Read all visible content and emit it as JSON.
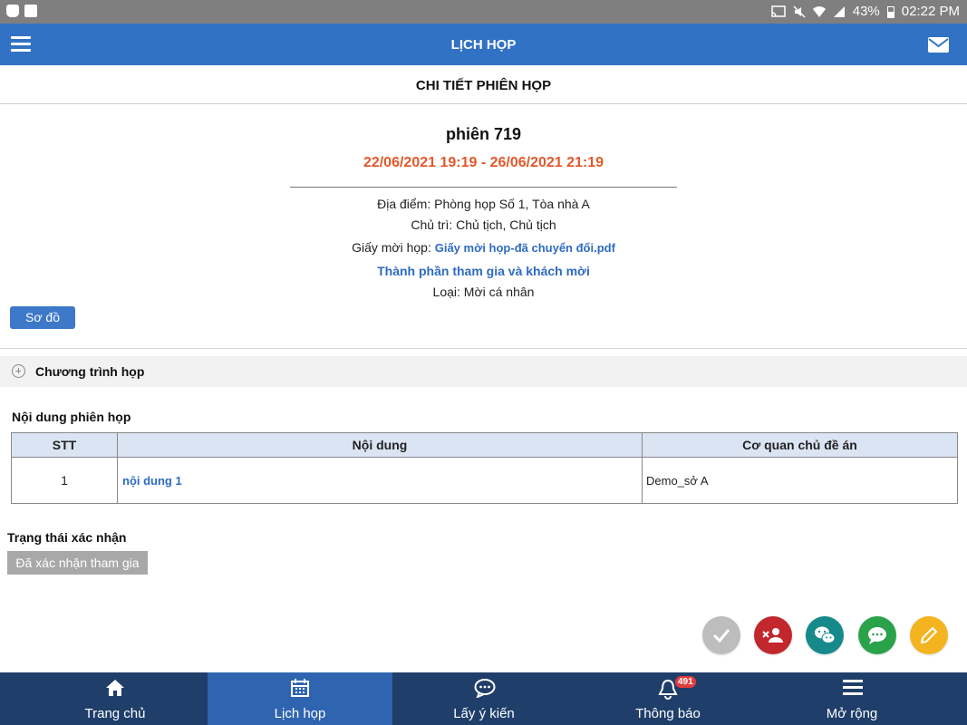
{
  "status_bar": {
    "battery": "43%",
    "time": "02:22 PM"
  },
  "app_bar": {
    "title": "LỊCH HỌP"
  },
  "sub_header": {
    "title": "CHI TIẾT PHIÊN HỌP"
  },
  "session": {
    "title": "phiên 719",
    "time_range": "22/06/2021 19:19 - 26/06/2021 21:19",
    "location_label": "Địa điểm: ",
    "location_value": "Phòng họp Số 1, Tòa nhà A",
    "chair_label": "Chủ trì: ",
    "chair_value": "Chủ tịch, Chủ tịch",
    "invitation_label": "Giấy mời họp: ",
    "invitation_file": "Giấy mời họp-đã chuyển đổi.pdf",
    "participants_link": "Thành phần tham gia và khách mời",
    "type_label": "Loại: ",
    "type_value": "Mời cá nhân"
  },
  "buttons": {
    "diagram": "Sơ đồ"
  },
  "program": {
    "label": "Chương trình họp"
  },
  "content_section": {
    "title": "Nội dung phiên họp",
    "columns": [
      "STT",
      "Nội dung",
      "Cơ quan chủ đề án"
    ],
    "rows": [
      {
        "stt": "1",
        "content": "nội dung 1",
        "agency": "Demo_sở A"
      }
    ]
  },
  "confirmation": {
    "title": "Trạng thái xác nhận",
    "status": "Đã xác nhận tham gia"
  },
  "fab_colors": {
    "confirm": "#bdbdbd",
    "decline": "#c1272d",
    "wechat": "#168a8a",
    "chat": "#2aa24a",
    "edit": "#f3b41f"
  },
  "bottom_nav": {
    "items": [
      {
        "label": "Trang chủ",
        "icon": "home-icon"
      },
      {
        "label": "Lịch họp",
        "icon": "calendar-icon",
        "active": true
      },
      {
        "label": "Lấy ý kiến",
        "icon": "chat-bubble-icon"
      },
      {
        "label": "Thông báo",
        "icon": "bell-icon",
        "badge": "491"
      },
      {
        "label": "Mở rộng",
        "icon": "menu-icon"
      }
    ]
  }
}
